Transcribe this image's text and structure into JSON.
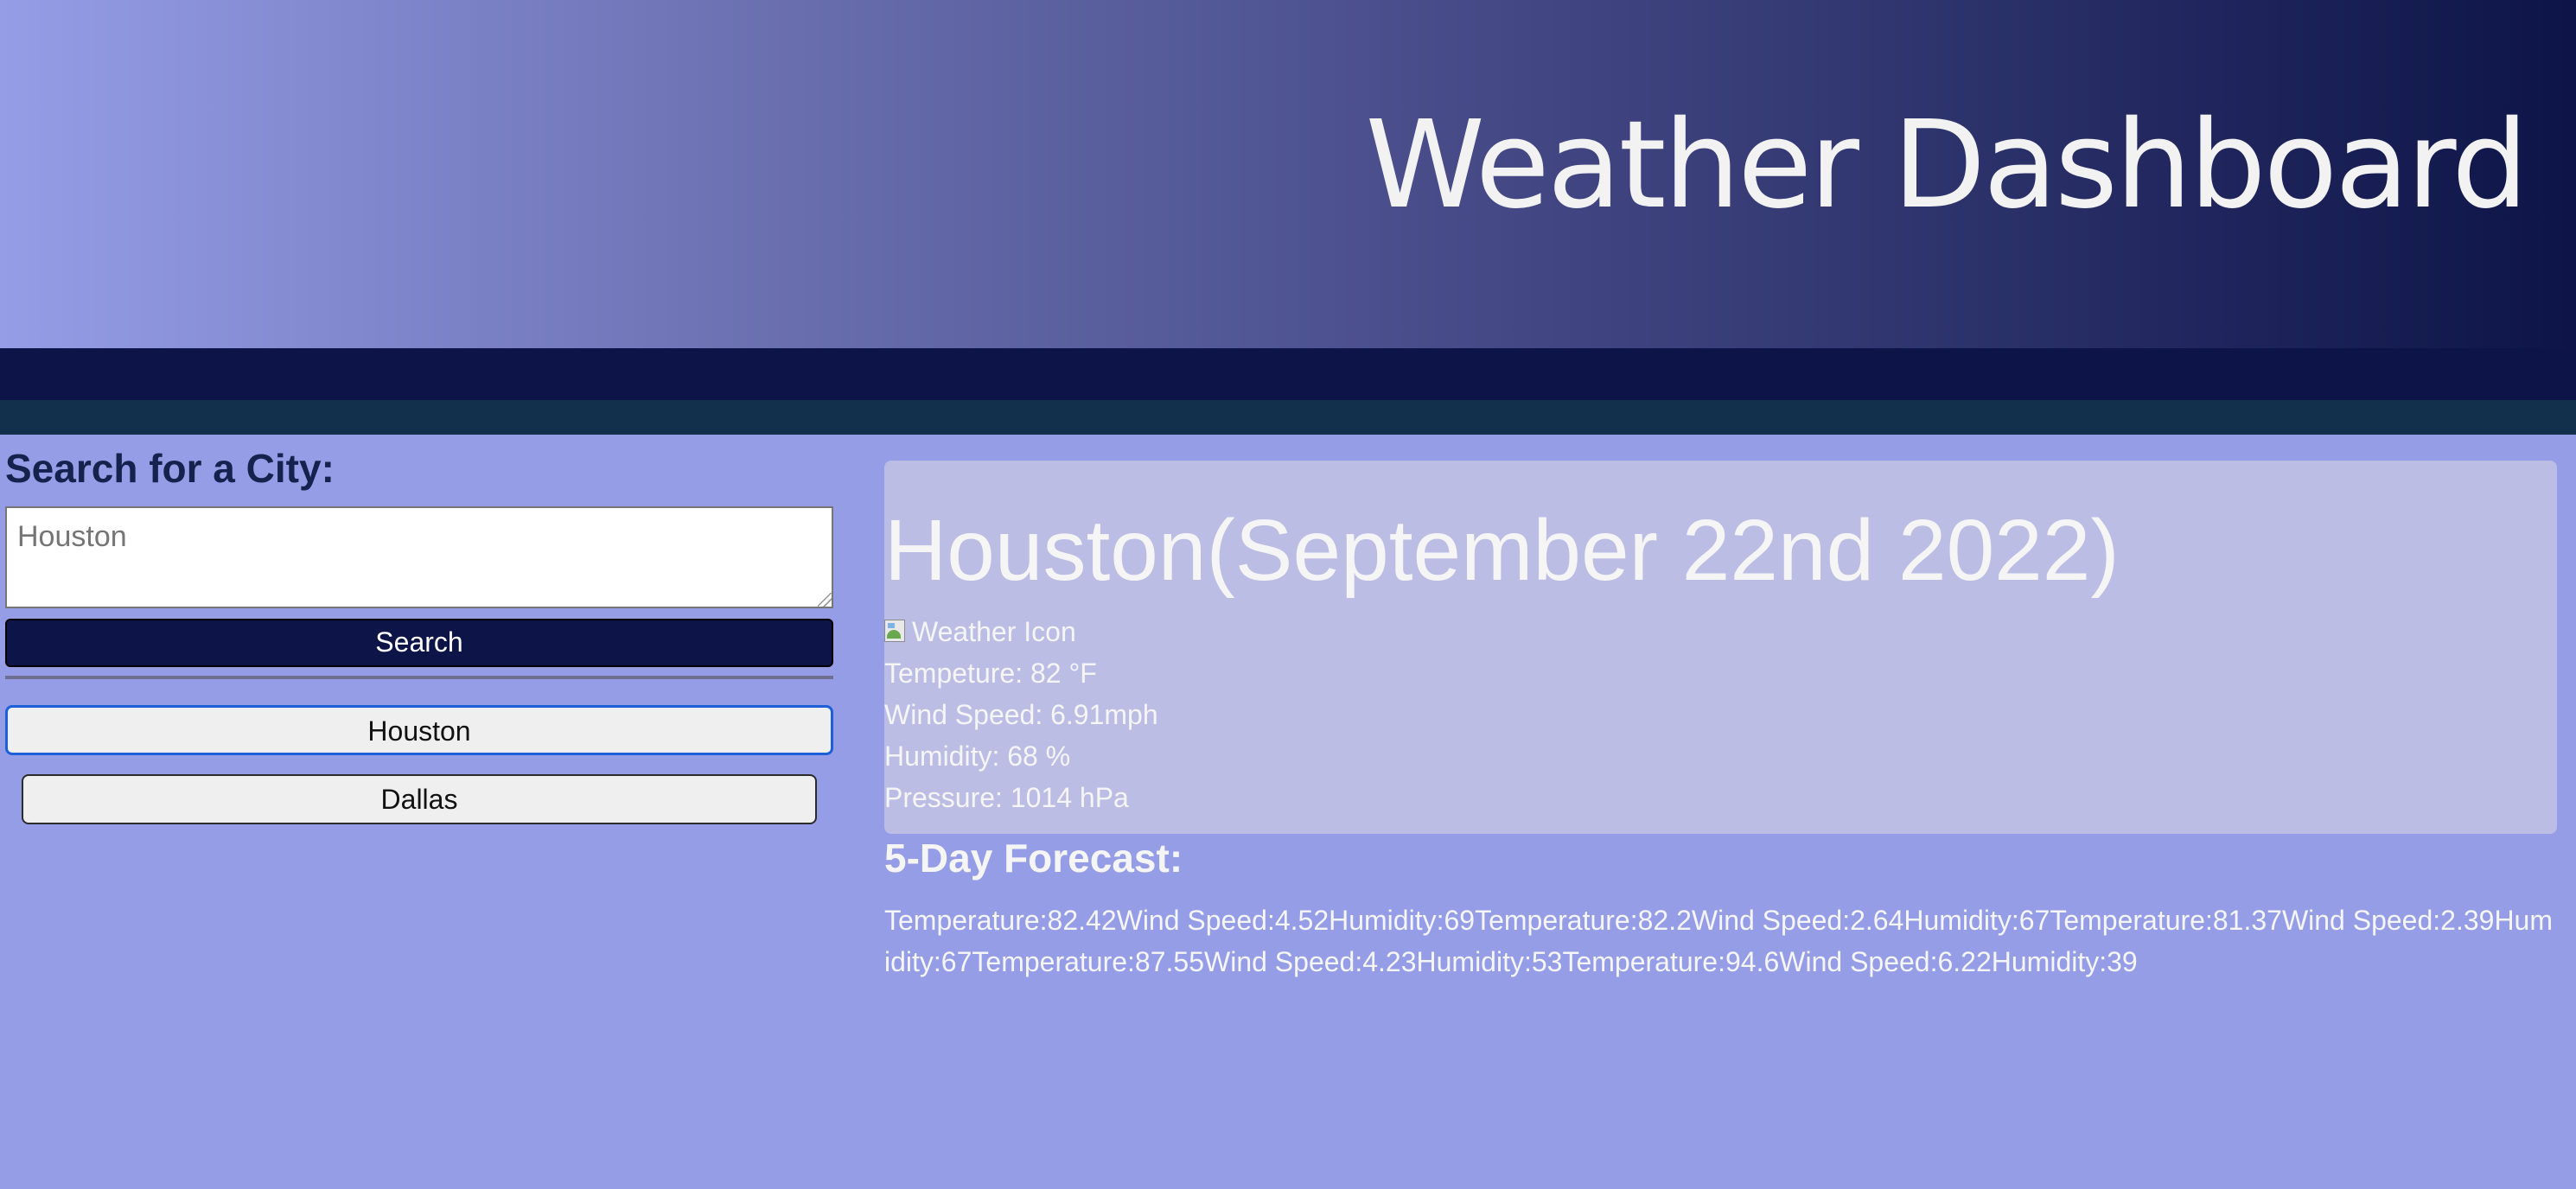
{
  "header": {
    "title": "Weather Dashboard"
  },
  "sidebar": {
    "heading": "Search for a City:",
    "search": {
      "value": "",
      "placeholder": "Houston"
    },
    "search_button_label": "Search",
    "history": [
      {
        "label": "Houston",
        "selected": true
      },
      {
        "label": "Dallas",
        "selected": false
      }
    ]
  },
  "current": {
    "title": "Houston(September 22nd 2022)",
    "icon_alt": "Weather Icon",
    "temperature": "Tempeture: 82 °F",
    "wind": "Wind Speed: 6.91mph",
    "humidity": "Humidity: 68 %",
    "pressure": "Pressure: 1014 hPa"
  },
  "forecast": {
    "heading": "5-Day Forecast:",
    "days": [
      {
        "temperature": "Temperature:82.42",
        "wind": "Wind Speed:4.52",
        "humidity": "Humidity:69"
      },
      {
        "temperature": "Temperature:82.2",
        "wind": "Wind Speed:2.64",
        "humidity": "Humidity:67"
      },
      {
        "temperature": "Temperature:81.37",
        "wind": "Wind Speed:2.39",
        "humidity": "Humidity:67"
      },
      {
        "temperature": "Temperature:87.55",
        "wind": "Wind Speed:4.23",
        "humidity": "Humidity:53"
      },
      {
        "temperature": "Temperature:94.6",
        "wind": "Wind Speed:6.22",
        "humidity": "Humidity:39"
      }
    ]
  },
  "colors": {
    "page_background": "#959de6",
    "header_gradient_start": "#959de6",
    "header_gradient_end": "#0d1447",
    "navy_bar": "#0d1447",
    "teal_bar": "#12304c",
    "card_background": "#bcbde4",
    "search_button": "#0d1447",
    "selected_outline": "#1d5fd8"
  }
}
